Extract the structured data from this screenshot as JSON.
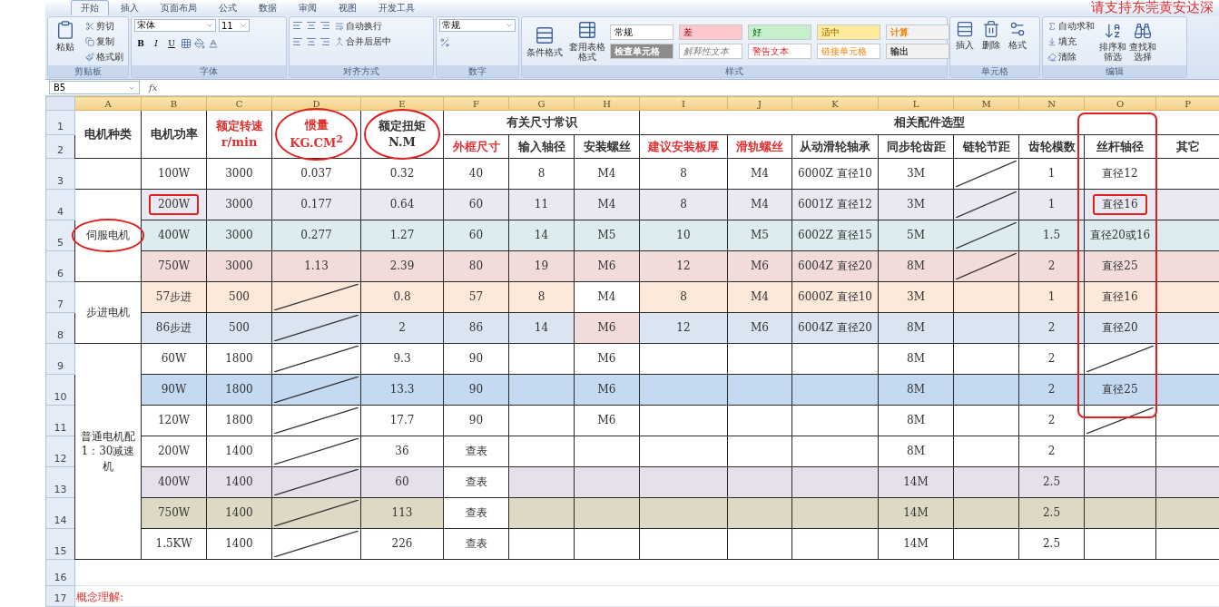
{
  "tabs": [
    {
      "label": "开始",
      "selected": true
    },
    {
      "label": "插入",
      "selected": false
    },
    {
      "label": "页面布局",
      "selected": false
    },
    {
      "label": "公式",
      "selected": false
    },
    {
      "label": "数据",
      "selected": false
    },
    {
      "label": "审阅",
      "selected": false
    },
    {
      "label": "视图",
      "selected": false
    },
    {
      "label": "开发工具",
      "selected": false
    }
  ],
  "banner": "请支持东莞黄安达深",
  "ribbon": {
    "groups": [
      {
        "kind": "clipboard",
        "label": "剪贴板",
        "big": "粘贴",
        "items": [
          "剪切",
          "复制",
          "格式刷"
        ]
      },
      {
        "kind": "font",
        "label": "字体",
        "font": "宋体",
        "size": "11",
        "buttons": [
          "B",
          "I",
          "U"
        ]
      },
      {
        "kind": "align",
        "label": "对齐方式",
        "items": [
          "自动换行",
          "合并后居中"
        ]
      },
      {
        "kind": "number",
        "label": "数字",
        "format": "常规"
      },
      {
        "kind": "styles",
        "label": "样式",
        "big": [
          "条件格式",
          "套用表格格式"
        ],
        "styles": [
          {
            "label": "常规",
            "kind": "normal",
            "color": "#ffffff"
          },
          {
            "label": "差",
            "kind": "bad",
            "color": "#ffc7ce"
          },
          {
            "label": "好",
            "kind": "good",
            "color": "#c6efce"
          },
          {
            "label": "适中",
            "kind": "neutral",
            "color": "#ffeb9c"
          },
          {
            "label": "计算",
            "kind": "calculation",
            "color": "#f2f2f2"
          },
          {
            "label": "检查单元格",
            "kind": "check",
            "color": "#8c8c8c"
          },
          {
            "label": "解释性文本",
            "kind": "explanatory",
            "color": "#ffffff"
          },
          {
            "label": "警告文本",
            "kind": "warning",
            "color": "#ffffff"
          },
          {
            "label": "链接单元格",
            "kind": "linked",
            "color": "#ffffff"
          },
          {
            "label": "输出",
            "kind": "output",
            "color": "#f2f2f2"
          }
        ]
      },
      {
        "kind": "cells",
        "label": "单元格",
        "big": [
          "插入",
          "删除",
          "格式"
        ]
      },
      {
        "kind": "edit",
        "label": "编辑",
        "items": [
          "自动求和",
          "填充",
          "清除"
        ],
        "big": [
          "排序和筛选",
          "查找和选择"
        ]
      }
    ]
  },
  "formula_bar": {
    "name_box": "B5",
    "fx": "fx"
  },
  "sheet": {
    "columns": [
      {
        "label": "A"
      },
      {
        "label": "B"
      },
      {
        "label": "C"
      },
      {
        "label": "D"
      },
      {
        "label": "E"
      },
      {
        "label": "F"
      },
      {
        "label": "G"
      },
      {
        "label": "H"
      },
      {
        "label": "I"
      },
      {
        "label": "J"
      },
      {
        "label": "K"
      },
      {
        "label": "L"
      },
      {
        "label": "M"
      },
      {
        "label": "N"
      },
      {
        "label": "O",
        "outlined": true
      },
      {
        "label": "P"
      }
    ],
    "rows": [
      {
        "num": "1",
        "kind": "header",
        "cells": [
          {
            "text": "电机种类",
            "rowspan": 2
          },
          {
            "text": "电机功率",
            "rowspan": 2
          },
          {
            "text": "额定转速\nr/min",
            "rowspan": 2,
            "red": true
          },
          {
            "text": "惯量\nKG.CM$^{2}$",
            "rowspan": 2,
            "red": true,
            "circled": true
          },
          {
            "text": "额定扭矩\nN.M",
            "rowspan": 2,
            "circled": true
          },
          {
            "text": "有关尺寸常识",
            "colspan": 3
          },
          {
            "text": "相关配件选型",
            "colspan": 8
          }
        ]
      },
      {
        "num": "2",
        "kind": "header",
        "cells": [
          {
            "text": "外框尺寸",
            "red": true
          },
          "输入轴径",
          "安装螺丝",
          {
            "text": "建议安装板厚",
            "red": true
          },
          {
            "text": "滑轨螺丝",
            "red": true
          },
          "从动滑轮轴承",
          "同步轮齿距",
          "链轮节距",
          "齿轮模数",
          "丝杆轴径",
          "其它"
        ]
      },
      {
        "num": "3",
        "kind": "data",
        "cells": [
          {
            "kind": "blank"
          },
          "100W",
          "3000",
          "0.037",
          "0.32",
          "40",
          "8",
          "M4",
          "8",
          "M4",
          "6000Z 直径10",
          "3M",
          {
            "kind": "slash"
          },
          "1",
          "直径12",
          {
            "kind": "blank"
          }
        ]
      },
      {
        "num": "4",
        "kind": "data",
        "color": "#e9e9f1",
        "cells": [
          {
            "text": "伺服电机",
            "rowspan": 3,
            "circled": true,
            "color": "#ffffff"
          },
          {
            "text": "200W",
            "boxed": true
          },
          "3000",
          "0.177",
          "0.64",
          "60",
          "11",
          "M4",
          "8",
          "M4",
          "6001Z 直径12",
          "3M",
          {
            "kind": "slash"
          },
          "1",
          {
            "text": "直径16",
            "boxed": true
          },
          {
            "kind": "blank"
          }
        ]
      },
      {
        "num": "5",
        "kind": "data",
        "color": "#dcecef",
        "cells": [
          "400W",
          "3000",
          "0.277",
          "1.27",
          "60",
          "14",
          "M5",
          "10",
          "M5",
          "6002Z 直径15",
          "5M",
          {
            "kind": "slash"
          },
          "1.5",
          "直径20或16",
          {
            "kind": "blank"
          }
        ]
      },
      {
        "num": "6",
        "kind": "data",
        "color": "#f2dcdb",
        "cells": [
          "750W",
          "3000",
          "1.13",
          "2.39",
          "80",
          "19",
          "M6",
          "12",
          "M6",
          "6004Z 直径20",
          "8M",
          {
            "kind": "slash"
          },
          "2",
          "直径25",
          {
            "kind": "blank"
          }
        ]
      },
      {
        "num": "7",
        "kind": "data",
        "color": "#fde9d9",
        "cells": [
          {
            "text": "步进电机",
            "rowspan": 2,
            "color": "#ffffff"
          },
          "57步进",
          "500",
          {
            "kind": "slash"
          },
          "0.8",
          "57",
          "8",
          {
            "text": "M4",
            "color": "#ffffff"
          },
          "8",
          "M4",
          "6000Z 直径10",
          "3M",
          {
            "kind": "blank"
          },
          "1",
          "直径16",
          {
            "kind": "blank"
          }
        ]
      },
      {
        "num": "8",
        "kind": "data",
        "color": "#dbe5f1",
        "cells": [
          "86步进",
          "500",
          {
            "kind": "slash"
          },
          "2",
          "86",
          "14",
          {
            "text": "M6",
            "color": "#f2dcdb"
          },
          "12",
          "M6",
          "6004Z 直径20",
          "8M",
          {
            "kind": "blank"
          },
          "2",
          "直径20",
          {
            "kind": "blank"
          }
        ]
      },
      {
        "num": "9",
        "kind": "data",
        "cells": [
          {
            "text": "普通电机配1：30减速机",
            "rowspan": 7
          },
          "60W",
          "1800",
          {
            "kind": "slash"
          },
          "9.3",
          "90",
          {
            "kind": "blank"
          },
          "M6",
          {
            "kind": "blank"
          },
          {
            "kind": "blank"
          },
          {
            "kind": "blank"
          },
          "8M",
          {
            "kind": "blank"
          },
          "2",
          {
            "kind": "slash"
          },
          {
            "kind": "blank"
          }
        ]
      },
      {
        "num": "10",
        "kind": "data",
        "color": "#c5d9f1",
        "cells": [
          "90W",
          "1800",
          {
            "kind": "slash"
          },
          "13.3",
          "90",
          {
            "kind": "blank"
          },
          "M6",
          {
            "kind": "blank"
          },
          {
            "kind": "blank"
          },
          {
            "kind": "blank"
          },
          "8M",
          {
            "kind": "blank"
          },
          "2",
          "直径25",
          {
            "kind": "blank"
          }
        ]
      },
      {
        "num": "11",
        "kind": "data",
        "cells": [
          "120W",
          "1800",
          {
            "kind": "slash"
          },
          "17.7",
          "90",
          {
            "kind": "blank"
          },
          "M6",
          {
            "kind": "blank"
          },
          {
            "kind": "blank"
          },
          {
            "kind": "blank"
          },
          "8M",
          {
            "kind": "blank"
          },
          "2",
          {
            "kind": "slash"
          },
          {
            "kind": "blank"
          }
        ]
      },
      {
        "num": "12",
        "kind": "data",
        "cells": [
          "200W",
          "1400",
          {
            "kind": "slash"
          },
          "36",
          "查表",
          {
            "kind": "blank"
          },
          {
            "kind": "blank"
          },
          {
            "kind": "blank"
          },
          {
            "kind": "blank"
          },
          {
            "kind": "blank"
          },
          "8M",
          {
            "kind": "blank"
          },
          "2",
          {
            "kind": "blank"
          },
          {
            "kind": "blank"
          }
        ]
      },
      {
        "num": "13",
        "kind": "data",
        "color": "#e5e0ec",
        "cells": [
          "400W",
          "1400",
          {
            "kind": "slash"
          },
          "60",
          {
            "text": "查表",
            "color": "#ffffff"
          },
          {
            "kind": "blank"
          },
          {
            "kind": "blank"
          },
          {
            "kind": "blank"
          },
          {
            "kind": "blank"
          },
          {
            "kind": "blank"
          },
          "14M",
          {
            "kind": "blank"
          },
          "2.5",
          {
            "kind": "blank"
          },
          {
            "kind": "blank"
          }
        ]
      },
      {
        "num": "14",
        "kind": "data",
        "color": "#ddd9c4",
        "cells": [
          "750W",
          "1400",
          {
            "kind": "slash"
          },
          "113",
          {
            "text": "查表",
            "color": "#ffffff"
          },
          {
            "kind": "blank"
          },
          {
            "kind": "blank"
          },
          {
            "kind": "blank"
          },
          {
            "kind": "blank"
          },
          {
            "kind": "blank"
          },
          "14M",
          {
            "kind": "blank"
          },
          "2.5",
          {
            "kind": "blank"
          },
          {
            "kind": "blank"
          }
        ]
      },
      {
        "num": "15",
        "kind": "data",
        "cells": [
          "1.5KW",
          "1400",
          {
            "kind": "slash"
          },
          "226",
          "查表",
          {
            "kind": "blank"
          },
          {
            "kind": "blank"
          },
          {
            "kind": "blank"
          },
          {
            "kind": "blank"
          },
          {
            "kind": "blank"
          },
          "14M",
          {
            "kind": "blank"
          },
          "2.5",
          {
            "kind": "blank"
          },
          {
            "kind": "blank"
          }
        ]
      },
      {
        "num": "16",
        "kind": "gap"
      },
      {
        "num": "17",
        "kind": "note",
        "text": "概念理解:"
      }
    ]
  }
}
